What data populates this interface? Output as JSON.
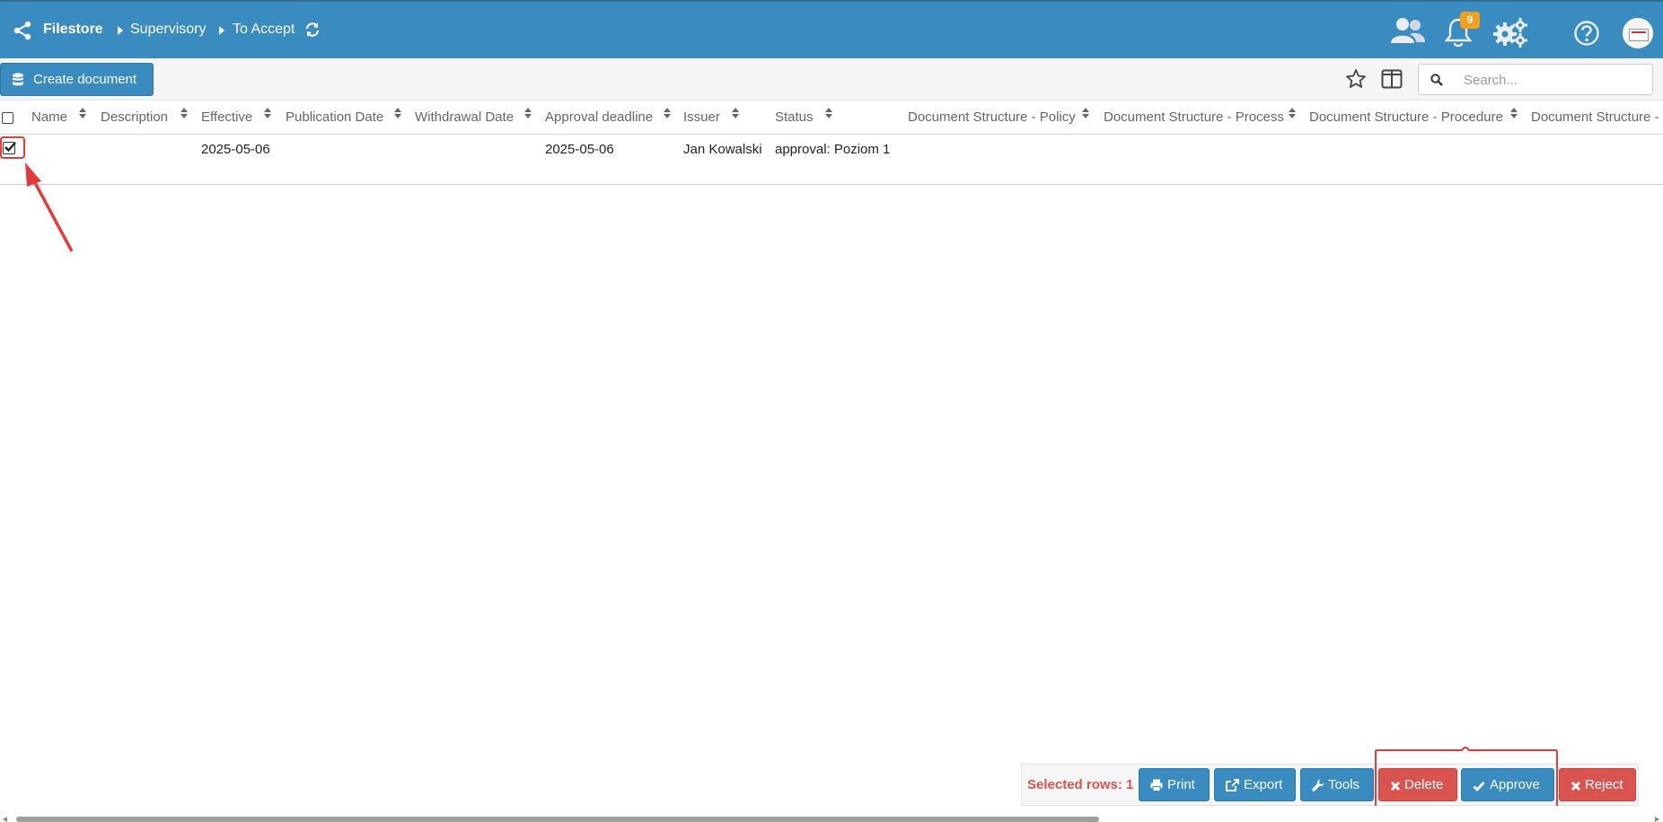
{
  "header": {
    "brand": "Filestore",
    "breadcrumbs": [
      "Supervisory",
      "To Accept"
    ],
    "notifications_count": "9",
    "icons": [
      "share-nodes-icon",
      "refresh-icon",
      "users-icon",
      "bell-icon",
      "gears-icon",
      "help-icon",
      "avatar"
    ]
  },
  "toolbar": {
    "create_label": "Create document",
    "search_placeholder": "Search..."
  },
  "table": {
    "columns": [
      "Name",
      "Description",
      "Effective",
      "Publication Date",
      "Withdrawal Date",
      "Approval deadline",
      "Issuer",
      "Status",
      "Document Structure - Policy",
      "Document Structure - Process",
      "Document Structure - Procedure",
      "Document Structure - I"
    ],
    "rows": [
      {
        "selected": true,
        "name": "",
        "description": "",
        "effective": "2025-05-06",
        "publication_date": "",
        "withdrawal_date": "",
        "approval_deadline": "2025-05-06",
        "issuer": "Jan Kowalski",
        "status": "approval: Poziom 1"
      }
    ]
  },
  "actions": {
    "selected_rows": "Selected rows: 1",
    "print": "Print",
    "export": "Export",
    "tools": "Tools",
    "delete": "Delete",
    "approve": "Approve",
    "reject": "Reject"
  },
  "colors": {
    "primary": "#3a8bbf",
    "danger": "#d9534f",
    "badge": "#f0a020",
    "annotation": "#e23b3b"
  }
}
